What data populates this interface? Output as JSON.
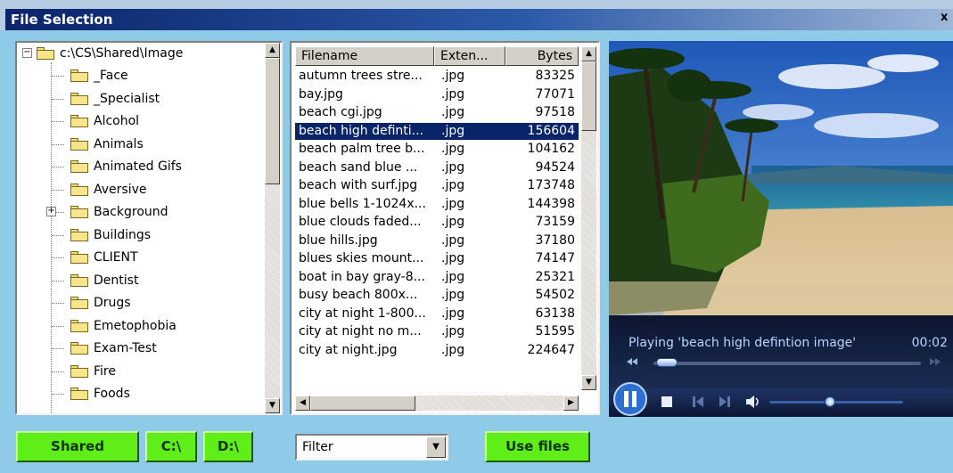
{
  "window": {
    "title": "File Selection",
    "close_glyph": "x"
  },
  "tree": {
    "root": "c:\\CS\\Shared\\Image",
    "items": [
      "_Face",
      "_Specialist",
      "Alcohol",
      "Animals",
      "Animated Gifs",
      "Aversive",
      "Background",
      "Buildings",
      "CLIENT",
      "Dentist",
      "Drugs",
      "Emetophobia",
      "Exam-Test",
      "Fire",
      "Foods"
    ],
    "expandable_index": 6
  },
  "file_list": {
    "columns": [
      "Filename",
      "Exten...",
      "Bytes"
    ],
    "rows": [
      [
        "autumn trees stre...",
        ".jpg",
        "83325"
      ],
      [
        "bay.jpg",
        ".jpg",
        "77071"
      ],
      [
        "beach cgi.jpg",
        ".jpg",
        "97518"
      ],
      [
        "beach high definti...",
        ".jpg",
        "156604"
      ],
      [
        "beach palm tree b...",
        ".jpg",
        "104162"
      ],
      [
        "beach sand blue ...",
        ".jpg",
        "94524"
      ],
      [
        "beach with surf.jpg",
        ".jpg",
        "173748"
      ],
      [
        "blue bells 1-1024x...",
        ".jpg",
        "144398"
      ],
      [
        "blue clouds faded...",
        ".jpg",
        "73159"
      ],
      [
        "blue hills.jpg",
        ".jpg",
        "37180"
      ],
      [
        "blues skies mount...",
        ".jpg",
        "74147"
      ],
      [
        "boat in bay gray-8...",
        ".jpg",
        "25321"
      ],
      [
        "busy beach 800x...",
        ".jpg",
        "54502"
      ],
      [
        "city at night 1-800...",
        ".jpg",
        "63138"
      ],
      [
        "city at night no m...",
        ".jpg",
        "51595"
      ],
      [
        "city at night.jpg",
        ".jpg",
        "224647"
      ]
    ],
    "selected_index": 3
  },
  "player": {
    "now_playing": "Playing 'beach high defintion image'",
    "time": "00:02",
    "seek_fraction": 0.05,
    "volume_fraction": 0.45
  },
  "bottom": {
    "shared_label": "Shared",
    "c_label": "C:\\",
    "d_label": "D:\\",
    "filter_value": "Filter",
    "use_files_label": "Use files"
  },
  "colors": {
    "background": "#8fcbe9",
    "button_green": "#5fee18",
    "selection": "#0a246a"
  }
}
